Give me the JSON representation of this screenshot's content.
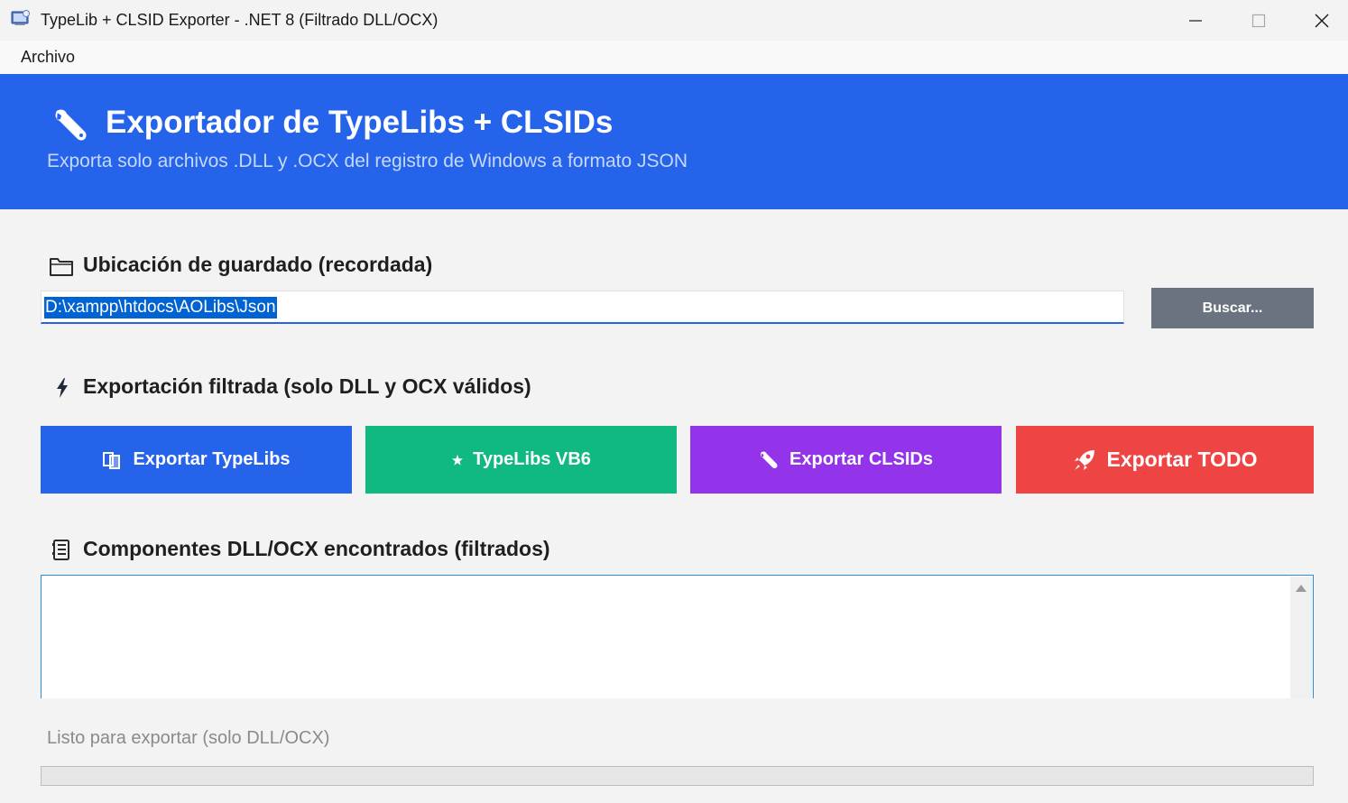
{
  "window": {
    "title": "TypeLib + CLSID Exporter - .NET 8 (Filtrado DLL/OCX)",
    "controls": [
      "minimize-icon",
      "maximize-icon",
      "close-icon"
    ]
  },
  "menu": {
    "items": [
      {
        "label": "Archivo"
      }
    ]
  },
  "header": {
    "icon": "wrench-icon",
    "title": "Exportador de TypeLibs + CLSIDs",
    "subtitle": "Exporta solo archivos .DLL y .OCX del registro de Windows a formato JSON",
    "background": "#2563eb"
  },
  "save_location": {
    "icon": "folder-icon",
    "heading": "Ubicación de guardado (recordada)",
    "path_value": "D:\\xampp\\htdocs\\AOLibs\\Json",
    "browse_label": "Buscar..."
  },
  "export": {
    "icon": "lightning-bolt-icon",
    "heading": "Exportación filtrada (solo DLL y OCX válidos)",
    "buttons": [
      {
        "label": "Exportar TypeLibs",
        "icon": "copy-documents-icon",
        "color": "#2563eb"
      },
      {
        "label": "TypeLibs VB6",
        "icon": "star-icon",
        "color": "#10b981"
      },
      {
        "label": "Exportar CLSIDs",
        "icon": "wrench-icon",
        "color": "#9333ea"
      },
      {
        "label": "Exportar TODO",
        "icon": "rocket-icon",
        "color": "#ef4444"
      }
    ]
  },
  "components": {
    "icon": "ledger-icon",
    "heading": "Componentes DLL/OCX encontrados (filtrados)",
    "items": []
  },
  "status": {
    "text": "Listo para exportar (solo DLL/OCX)",
    "progress": 0
  }
}
